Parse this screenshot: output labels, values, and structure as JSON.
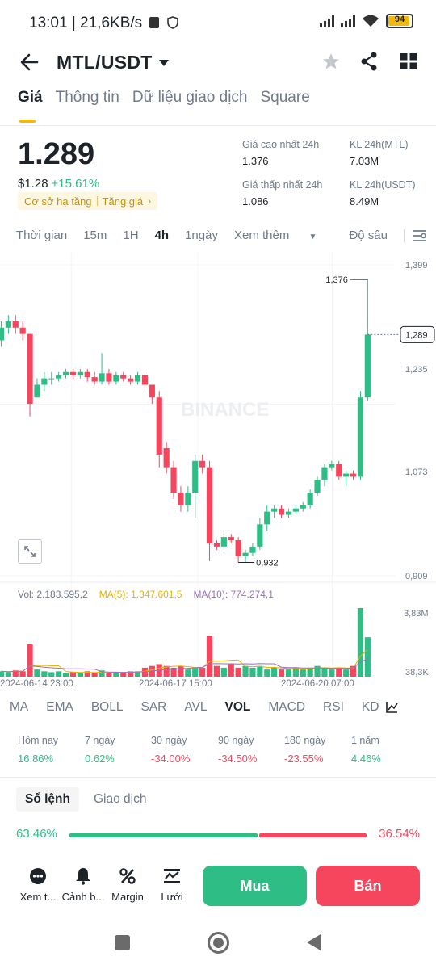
{
  "status_bar": {
    "time": "13:01",
    "speed": "21,6KB/s",
    "battery": "94"
  },
  "header": {
    "pair": "MTL/USDT"
  },
  "tabs": [
    "Giá",
    "Thông tin",
    "Dữ liệu giao dịch",
    "Square"
  ],
  "ticker": {
    "price": "1.289",
    "usd_price": "$1.28",
    "change": "+15.61%",
    "tag1": "Cơ sở hạ tầng",
    "tag2": "Tăng giá",
    "high_label": "Giá cao nhất 24h",
    "high_value": "1.376",
    "vol_mtl_label": "KL 24h(MTL)",
    "vol_mtl_value": "7.03M",
    "low_label": "Giá thấp nhất 24h",
    "low_value": "1.086",
    "vol_usdt_label": "KL 24h(USDT)",
    "vol_usdt_value": "8.49M"
  },
  "timeframes": [
    "Thời gian",
    "15m",
    "1H",
    "4h",
    "1ngày",
    "Xem thêm",
    "Độ sâu"
  ],
  "timeframe_selected": "4h",
  "chart_data": {
    "type": "candlestick",
    "interval": "4h",
    "watermark": "BINANCE",
    "y_ticks": [
      "1,399",
      "1,235",
      "1,073",
      "0,909"
    ],
    "y_range": [
      0.909,
      1.399
    ],
    "current_price_label": "1,289",
    "max_label": "1,376",
    "min_label": "0,932",
    "x_labels": [
      "2024-06-14 23:00",
      "2024-06-17 15:00",
      "2024-06-20 07:00"
    ],
    "candles": [
      [
        1.28,
        1.3,
        1.27,
        1.31
      ],
      [
        1.3,
        1.31,
        1.29,
        1.32
      ],
      [
        1.31,
        1.3,
        1.29,
        1.32
      ],
      [
        1.3,
        1.29,
        1.28,
        1.31
      ],
      [
        1.29,
        1.18,
        1.16,
        1.29
      ],
      [
        1.19,
        1.21,
        1.19,
        1.22
      ],
      [
        1.21,
        1.22,
        1.2,
        1.23
      ],
      [
        1.22,
        1.22,
        1.21,
        1.23
      ],
      [
        1.22,
        1.225,
        1.215,
        1.23
      ],
      [
        1.225,
        1.23,
        1.22,
        1.235
      ],
      [
        1.23,
        1.225,
        1.22,
        1.235
      ],
      [
        1.225,
        1.23,
        1.22,
        1.235
      ],
      [
        1.23,
        1.222,
        1.215,
        1.235
      ],
      [
        1.222,
        1.215,
        1.21,
        1.23
      ],
      [
        1.215,
        1.228,
        1.21,
        1.26
      ],
      [
        1.228,
        1.215,
        1.21,
        1.235
      ],
      [
        1.215,
        1.225,
        1.21,
        1.23
      ],
      [
        1.225,
        1.22,
        1.215,
        1.23
      ],
      [
        1.22,
        1.215,
        1.21,
        1.225
      ],
      [
        1.215,
        1.225,
        1.21,
        1.23
      ],
      [
        1.225,
        1.21,
        1.2,
        1.23
      ],
      [
        1.21,
        1.19,
        1.18,
        1.21
      ],
      [
        1.19,
        1.1,
        1.08,
        1.2
      ],
      [
        1.11,
        1.08,
        1.07,
        1.12
      ],
      [
        1.08,
        1.04,
        1.03,
        1.09
      ],
      [
        1.04,
        1.02,
        1.01,
        1.05
      ],
      [
        1.02,
        1.04,
        1.01,
        1.05
      ],
      [
        1.04,
        1.09,
        1.0,
        1.1
      ],
      [
        1.09,
        1.08,
        1.07,
        1.1
      ],
      [
        1.08,
        0.96,
        0.932,
        1.09
      ],
      [
        0.96,
        0.955,
        0.95,
        0.965
      ],
      [
        0.955,
        0.97,
        0.95,
        0.98
      ],
      [
        0.97,
        0.965,
        0.96,
        0.975
      ],
      [
        0.965,
        0.94,
        0.93,
        0.97
      ],
      [
        0.94,
        0.945,
        0.93,
        0.95
      ],
      [
        0.945,
        0.955,
        0.94,
        0.96
      ],
      [
        0.955,
        0.99,
        0.95,
        1.0
      ],
      [
        0.99,
        1.01,
        0.98,
        1.02
      ],
      [
        1.01,
        1.015,
        1.0,
        1.02
      ],
      [
        1.015,
        1.005,
        1.0,
        1.02
      ],
      [
        1.005,
        1.01,
        1.0,
        1.015
      ],
      [
        1.01,
        1.015,
        1.005,
        1.02
      ],
      [
        1.015,
        1.02,
        1.01,
        1.025
      ],
      [
        1.02,
        1.04,
        1.015,
        1.045
      ],
      [
        1.04,
        1.06,
        1.035,
        1.065
      ],
      [
        1.06,
        1.08,
        1.05,
        1.085
      ],
      [
        1.08,
        1.085,
        1.075,
        1.09
      ],
      [
        1.085,
        1.065,
        1.06,
        1.09
      ],
      [
        1.065,
        1.07,
        1.05,
        1.075
      ],
      [
        1.07,
        1.065,
        1.06,
        1.075
      ],
      [
        1.065,
        1.19,
        1.06,
        1.2
      ],
      [
        1.19,
        1.289,
        1.185,
        1.376
      ]
    ],
    "volume": {
      "summary_vol": "Vol: 2.183.595,2",
      "ma5": "MA(5): 1.347.601,5",
      "ma10": "MA(10): 774.274,1",
      "y_ticks": [
        "3,83M",
        "38,3K"
      ],
      "values": [
        0.3,
        0.25,
        0.35,
        0.3,
        1.8,
        0.4,
        0.3,
        0.25,
        0.3,
        0.2,
        0.25,
        0.2,
        0.3,
        0.2,
        0.35,
        0.2,
        0.25,
        0.2,
        0.3,
        0.3,
        0.5,
        0.6,
        0.7,
        0.6,
        0.5,
        0.6,
        0.4,
        0.5,
        0.5,
        2.3,
        0.6,
        0.5,
        0.7,
        0.5,
        0.6,
        0.5,
        0.6,
        0.4,
        0.5,
        0.4,
        0.4,
        0.5,
        0.4,
        0.5,
        0.6,
        0.5,
        0.4,
        0.5,
        0.4,
        0.6,
        3.83,
        2.2
      ]
    }
  },
  "indicators": [
    "MA",
    "EMA",
    "BOLL",
    "SAR",
    "AVL",
    "VOL",
    "MACD",
    "RSI",
    "KD"
  ],
  "indicator_selected": "VOL",
  "performance": [
    {
      "label": "Hôm nay",
      "value": "16.86%",
      "dir": "up"
    },
    {
      "label": "7 ngày",
      "value": "0.62%",
      "dir": "up"
    },
    {
      "label": "30 ngày",
      "value": "-34.00%",
      "dir": "down"
    },
    {
      "label": "90 ngày",
      "value": "-34.50%",
      "dir": "down"
    },
    {
      "label": "180 ngày",
      "value": "-23.55%",
      "dir": "down"
    },
    {
      "label": "1 năm",
      "value": "4.46%",
      "dir": "up"
    }
  ],
  "orderbook_tabs": [
    "Sổ lệnh",
    "Giao dịch"
  ],
  "ratio": {
    "buy_pct": "63.46%",
    "sell_pct": "36.54%",
    "buy_fraction": 0.6346
  },
  "actions": {
    "more": "Xem t...",
    "alert": "Cảnh b...",
    "margin": "Margin",
    "grid": "Lưới",
    "buy": "Mua",
    "sell": "Bán"
  },
  "colors": {
    "up": "#2ebd85",
    "down": "#f6465d",
    "accent": "#f0b90b"
  }
}
